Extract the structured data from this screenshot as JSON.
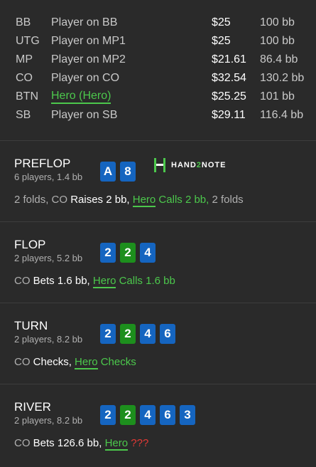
{
  "players": [
    {
      "pos": "BB",
      "name": "Player on BB",
      "amount": "$25",
      "bb": "100 bb"
    },
    {
      "pos": "UTG",
      "name": "Player on MP1",
      "amount": "$25",
      "bb": "100 bb"
    },
    {
      "pos": "MP",
      "name": "Player on MP2",
      "amount": "$21.61",
      "bb": "86.4 bb"
    },
    {
      "pos": "CO",
      "name": "Player on CO",
      "amount": "$32.54",
      "bb": "130.2 bb"
    },
    {
      "pos": "BTN",
      "name": "Hero (Hero)",
      "amount": "$25.25",
      "bb": "101 bb"
    },
    {
      "pos": "SB",
      "name": "Player on SB",
      "amount": "$29.11",
      "bb": "116.4 bb"
    }
  ],
  "logo": {
    "pre": "HAND",
    "two": "2",
    "post": "NOTE"
  },
  "preflop": {
    "name": "PREFLOP",
    "info": "6 players, 1.4 bb",
    "cards": [
      "A",
      "8"
    ],
    "a1": "2 folds, CO ",
    "a2": "Raises 2 bb, ",
    "hero": "Hero",
    "a3": " Calls 2 bb,",
    "a4": " 2 folds"
  },
  "flop": {
    "name": "FLOP",
    "info": "2 players, 5.2 bb",
    "cards": [
      "2",
      "2",
      "4"
    ],
    "a1": "CO ",
    "a2": "Bets 1.6 bb, ",
    "hero": "Hero",
    "a3": " Calls 1.6 bb"
  },
  "turn": {
    "name": "TURN",
    "info": "2 players, 8.2 bb",
    "cards": [
      "2",
      "2",
      "4",
      "6"
    ],
    "a1": "CO ",
    "a2": "Checks, ",
    "hero": "Hero",
    "a3": " Checks"
  },
  "river": {
    "name": "RIVER",
    "info": "2 players, 8.2 bb",
    "cards": [
      "2",
      "2",
      "4",
      "6",
      "3"
    ],
    "a1": "CO ",
    "a2": "Bets 126.6 bb, ",
    "hero": "Hero",
    "a3": " ???"
  },
  "colors": {
    "card_blue": "#1565c0",
    "card_green": "#1d8f1d",
    "hero": "#4cc84c",
    "danger": "#e53935"
  }
}
